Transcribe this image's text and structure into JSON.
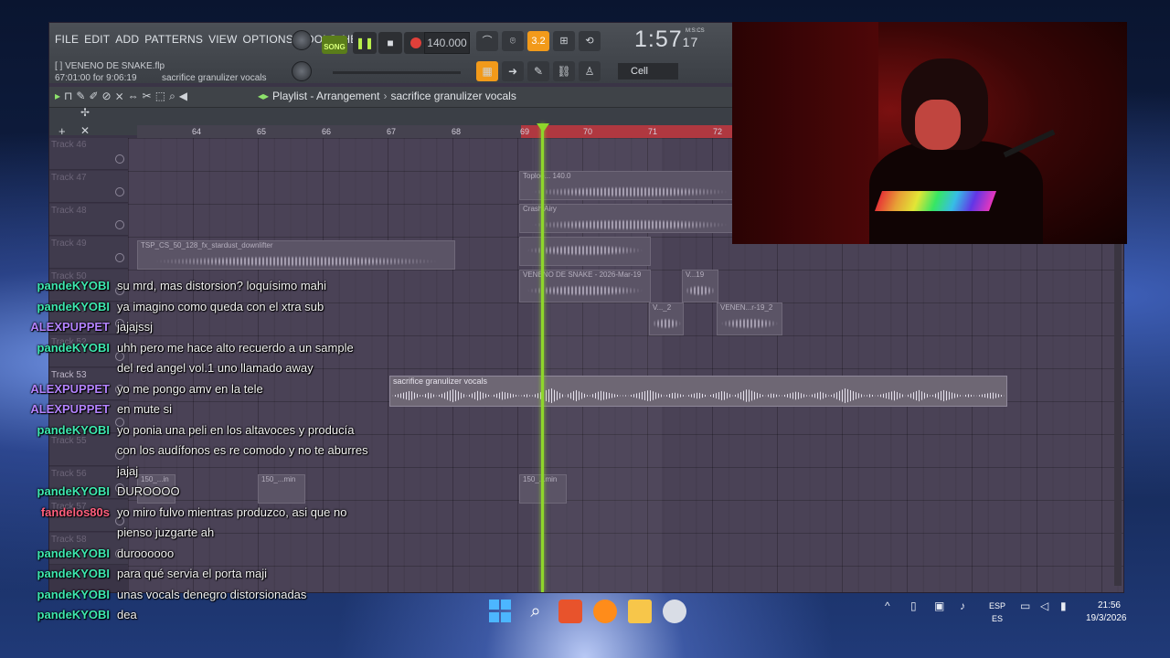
{
  "menu": [
    "FILE",
    "EDIT",
    "ADD",
    "PATTERNS",
    "VIEW",
    "OPTIONS",
    "TOOLS",
    "HELP"
  ],
  "transport": {
    "song_label": "SONG",
    "tempo": "140.000",
    "time": "1:57",
    "time_small": "17",
    "time_unit": "M:S:CS",
    "snap": "Cell",
    "pattern_num": "3.2"
  },
  "hint": {
    "project": "[ ] VENENO DE SNAKE.flp",
    "time": "67:01:00 for 9:06:19",
    "channel": "sacrifice granulizer vocals"
  },
  "playlist": {
    "title": "Playlist - Arrangement",
    "sep": "›",
    "current": "sacrifice granulizer vocals"
  },
  "ruler_labels": [
    "64",
    "65",
    "66",
    "67",
    "68",
    "69",
    "70",
    "71",
    "72"
  ],
  "tracks": [
    "Track 46",
    "Track 47",
    "Track 48",
    "Track 49",
    "Track 50",
    "Track 51",
    "Track 52",
    "Track 53",
    "Track 54",
    "Track 55",
    "Track 56",
    "Track 57",
    "Track 58"
  ],
  "clips": {
    "c1": "TSP_CS_50_128_fx_stardust_downlifter",
    "c2": "Toploo... 140.0",
    "c3": "Crash Airy",
    "c4": "VENENO DE SNAKE - 2026-Mar-19",
    "c5": "V...19",
    "c6": "V..._2",
    "c7": "VENEN...r-19_2",
    "c8": "150_...in",
    "c9": "150_...min",
    "c10": "150_...min",
    "main": "sacrifice granulizer vocals"
  },
  "chat": [
    {
      "user": "pandeKYOBI",
      "color": "#3ee8b0",
      "msg": "su mrd, mas distorsion? loquísimo mahi",
      "cont": ""
    },
    {
      "user": "pandeKYOBI",
      "color": "#3ee8b0",
      "msg": "ya imagino como queda con el xtra sub",
      "cont": ""
    },
    {
      "user": "ALEXPUPPET",
      "color": "#b483ff",
      "msg": "jajajssj",
      "cont": ""
    },
    {
      "user": "pandeKYOBI",
      "color": "#3ee8b0",
      "msg": "uhh pero me hace alto recuerdo a un sample",
      "cont": "del red angel vol.1 uno llamado away"
    },
    {
      "user": "ALEXPUPPET",
      "color": "#b483ff",
      "msg": "yo me pongo amv en la tele",
      "cont": ""
    },
    {
      "user": "ALEXPUPPET",
      "color": "#b483ff",
      "msg": "en mute si",
      "cont": ""
    },
    {
      "user": "pandeKYOBI",
      "color": "#3ee8b0",
      "msg": "yo ponia una peli en los altavoces y producía",
      "cont": "con los audífonos es re comodo y no te aburres"
    },
    {
      "user": "",
      "color": "#3ee8b0",
      "msg": "jajaj",
      "cont": ""
    },
    {
      "user": "pandeKYOBI",
      "color": "#3ee8b0",
      "msg": "DUROOOO",
      "cont": ""
    },
    {
      "user": "fandelos80s",
      "color": "#ff5f7e",
      "msg": "yo miro fulvo mientras produzco, asi que no",
      "cont": "pienso juzgarte ah"
    },
    {
      "user": "pandeKYOBI",
      "color": "#3ee8b0",
      "msg": "duroooooo",
      "cont": ""
    },
    {
      "user": "pandeKYOBI",
      "color": "#3ee8b0",
      "msg": "para qué servia el porta maji",
      "cont": ""
    },
    {
      "user": "pandeKYOBI",
      "color": "#3ee8b0",
      "msg": "unas vocals denegro distorsionadas",
      "cont": ""
    },
    {
      "user": "pandeKYOBI",
      "color": "#3ee8b0",
      "msg": "dea",
      "cont": ""
    }
  ],
  "taskbar": {
    "lang_top": "ESP",
    "lang_bottom": "ES",
    "time": "21:56",
    "date": "19/3/2026",
    "tray_chevron": "^"
  },
  "colors": {
    "accent_orange": "#f29a1a",
    "playhead": "#8ed62b",
    "ruler_highlight": "#b03840"
  }
}
